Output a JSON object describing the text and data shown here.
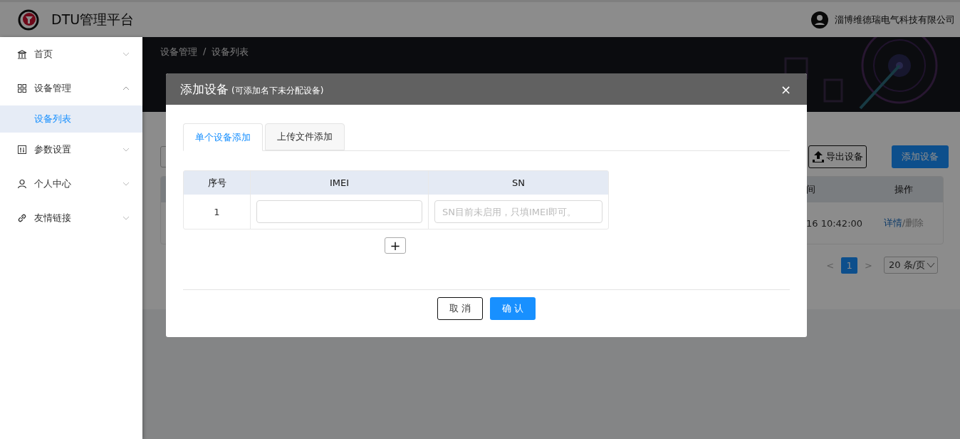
{
  "header": {
    "title": "DTU管理平台",
    "company": "淄博维德瑞电气科技有限公司"
  },
  "sidebar": {
    "items": [
      {
        "label": "首页",
        "expanded": false
      },
      {
        "label": "设备管理",
        "expanded": true,
        "children": [
          {
            "label": "设备列表",
            "selected": true
          }
        ]
      },
      {
        "label": "参数设置",
        "expanded": false
      },
      {
        "label": "个人中心",
        "expanded": false
      },
      {
        "label": "友情链接",
        "expanded": false
      }
    ]
  },
  "banner": {
    "breadcrumb": [
      "设备管理",
      "设备列表"
    ],
    "separator": "/"
  },
  "content": {
    "buttons": [
      {
        "label": "导出设备",
        "kind": "export"
      },
      {
        "label": "添加设备",
        "kind": "primary"
      }
    ],
    "table": {
      "columns": [
        "间",
        "操作"
      ],
      "rows": [
        {
          "time": "16 10:42:00",
          "detail": "详情",
          "separator": "/",
          "delete": "删除"
        }
      ]
    },
    "pagination": {
      "prev": "<",
      "pages": [
        {
          "label": "1",
          "selected": true
        }
      ],
      "next": ">",
      "page_size": "20 条/页"
    }
  },
  "modal": {
    "title": "添加设备",
    "subtitle": "(可添加名下未分配设备)",
    "close": "×",
    "tabs": [
      {
        "label": "单个设备添加",
        "selected": true
      },
      {
        "label": "上传文件添加",
        "selected": false
      }
    ],
    "table": {
      "columns": [
        "序号",
        "IMEI",
        "SN"
      ],
      "rows": [
        {
          "index": "1",
          "sn": {
            "placeholder": "SN目前未启用，只填IMEI即可。"
          }
        }
      ]
    },
    "add_row": "+",
    "buttons": [
      {
        "label": "取 消",
        "kind": "default"
      },
      {
        "label": "确 认",
        "kind": "primary"
      }
    ]
  }
}
